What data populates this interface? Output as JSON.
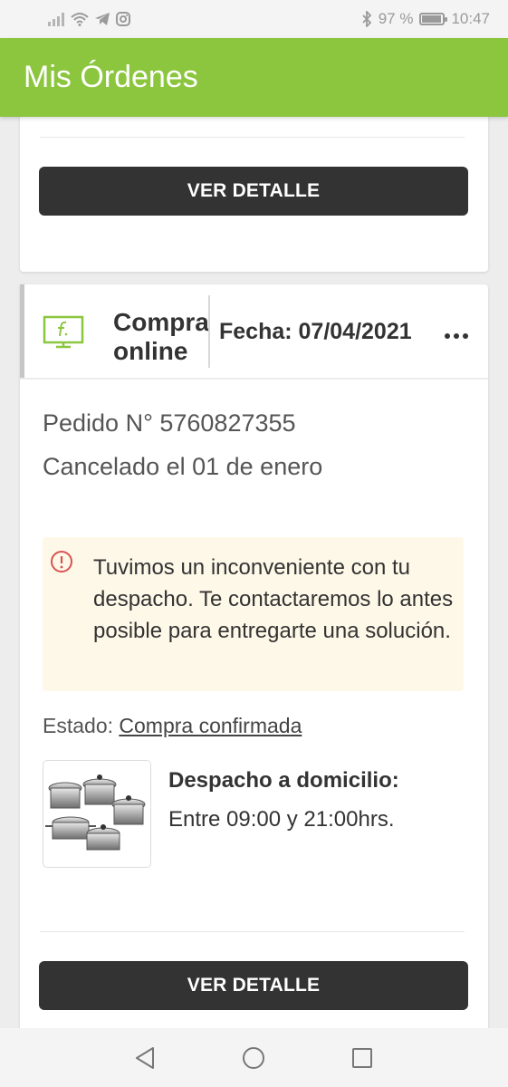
{
  "status_bar": {
    "battery": "97 %",
    "battery_level": 0.97,
    "time": "10:47",
    "icons": [
      "signal-icon",
      "wifi-icon",
      "telegram-icon",
      "instagram-icon",
      "bluetooth-icon",
      "battery-icon"
    ]
  },
  "app_bar": {
    "title": "Mis Órdenes",
    "color": "#8cc63f"
  },
  "orders": [
    {
      "button_label": "VER DETALLE"
    },
    {
      "channel_icon": "falabella-screen-icon",
      "channel": "Compra online",
      "date": "Fecha: 07/04/2021",
      "menu_icon": "more-dots-icon",
      "order_number": "Pedido N° 5760827355",
      "status_line": "Cancelado el 01 de enero",
      "alert": {
        "icon": "alert-circle-icon",
        "text": "Tuvimos un inconveniente con tu despacho. Te contactaremos lo antes posible para entregarte una solución."
      },
      "state_label": "Estado:",
      "state_value": "Compra confirmada",
      "delivery_title": "Despacho a domicilio:",
      "delivery_time": "Entre 09:00 y 21:00hrs.",
      "product_image": "cookware-pots-set",
      "button_label": "VER DETALLE"
    }
  ],
  "nav_bar": {
    "icons": [
      "back-triangle-icon",
      "home-circle-icon",
      "recents-square-icon"
    ]
  },
  "colors": {
    "accent": "#8cc63f",
    "button": "#333333",
    "alert_bg": "#fef8e8",
    "alert_icon": "#d9534f"
  }
}
